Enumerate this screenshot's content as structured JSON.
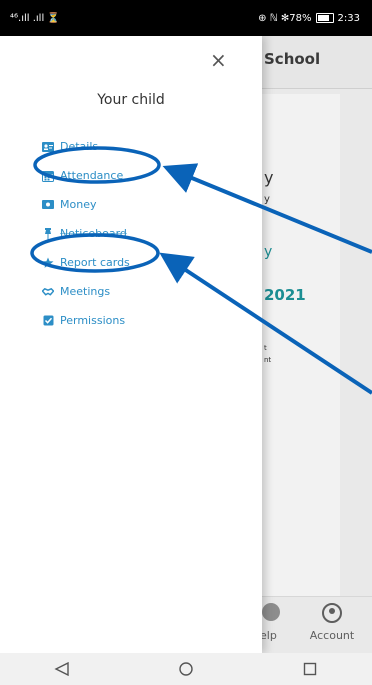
{
  "status_bar": {
    "left": "⁴⁶.ıll .ıll ⏳",
    "right": "⊕ ℕ ✻78%",
    "battery_percent": 78,
    "time": "2:33"
  },
  "background_app": {
    "header_title": "School",
    "text_items": [
      "y",
      "y",
      "y",
      "2021",
      "t",
      "nt"
    ],
    "bottom_nav": {
      "help_label": "elp",
      "account_label": "Account"
    }
  },
  "drawer": {
    "close_glyph": "×",
    "title": "Your child",
    "menu": [
      {
        "label": "Details",
        "icon": "id-card-icon"
      },
      {
        "label": "Attendance",
        "icon": "calendar-icon"
      },
      {
        "label": "Money",
        "icon": "money-icon"
      },
      {
        "label": "Noticeboard",
        "icon": "pin-icon"
      },
      {
        "label": "Report cards",
        "icon": "star-icon"
      },
      {
        "label": "Meetings",
        "icon": "handshake-icon"
      },
      {
        "label": "Permissions",
        "icon": "checkbox-icon"
      }
    ]
  },
  "annotation_color": "#0a63b8",
  "nav_bar": {
    "back": "◁",
    "home": "○",
    "recents": "□"
  }
}
